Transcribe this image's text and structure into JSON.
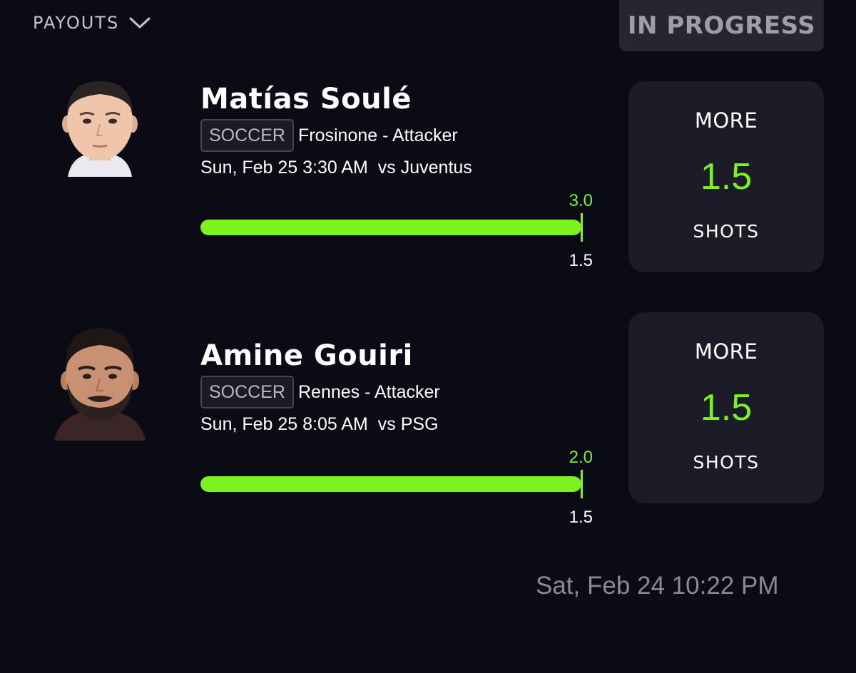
{
  "header": {
    "payouts_label": "PAYOUTS",
    "status": "IN PROGRESS"
  },
  "picks": [
    {
      "player_name": "Matías Soulé",
      "sport": "SOCCER",
      "team_position": "Frosinone - Attacker",
      "game_time": "Sun, Feb 25 3:30 AM",
      "opponent": "vs Juventus",
      "actual": "3.0",
      "line": "1.5",
      "progress_fraction": 1.0,
      "choice": "MORE",
      "projection": "1.5",
      "stat": "SHOTS"
    },
    {
      "player_name": "Amine Gouiri",
      "sport": "SOCCER",
      "team_position": "Rennes - Attacker",
      "game_time": "Sun, Feb 25 8:05 AM",
      "opponent": "vs PSG",
      "actual": "2.0",
      "line": "1.5",
      "progress_fraction": 1.0,
      "choice": "MORE",
      "projection": "1.5",
      "stat": "SHOTS"
    }
  ],
  "footer": {
    "timestamp": "Sat, Feb 24 10:22 PM"
  },
  "colors": {
    "background": "#0b0b16",
    "accent": "#7cf31f",
    "card": "#1c1c28",
    "badge": "#25262f"
  },
  "icons": {
    "payouts_toggle": "chevron-down-icon",
    "avatar": "player-photo"
  }
}
